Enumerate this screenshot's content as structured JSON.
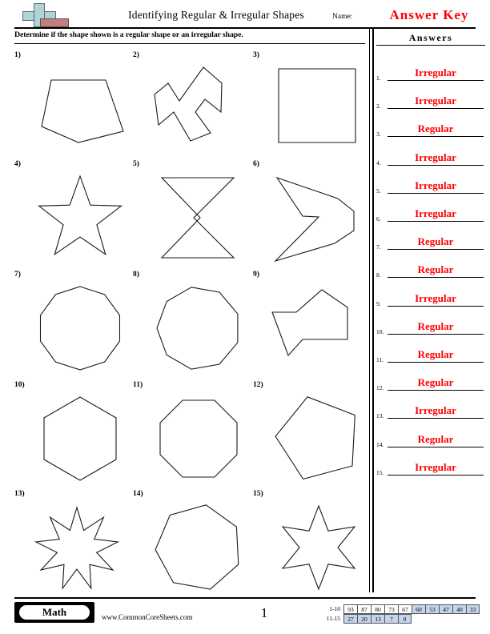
{
  "header": {
    "title": "Identifying Regular & Irregular Shapes",
    "name_label": "Name:",
    "answer_key": "Answer Key",
    "logo_colors": {
      "plus": "#aed4d8",
      "block": "#c08080"
    }
  },
  "instructions": "Determine if the shape shown is a regular shape or an irregular shape.",
  "answers_panel": {
    "heading": "Answers",
    "accent_color": "#ff0000",
    "rows": [
      {
        "num": "1.",
        "value": "Irregular"
      },
      {
        "num": "2.",
        "value": "Irregular"
      },
      {
        "num": "3.",
        "value": "Regular"
      },
      {
        "num": "4.",
        "value": "Irregular"
      },
      {
        "num": "5.",
        "value": "Irregular"
      },
      {
        "num": "6.",
        "value": "Irregular"
      },
      {
        "num": "7.",
        "value": "Regular"
      },
      {
        "num": "8.",
        "value": "Regular"
      },
      {
        "num": "9.",
        "value": "Irregular"
      },
      {
        "num": "10.",
        "value": "Regular"
      },
      {
        "num": "11.",
        "value": "Regular"
      },
      {
        "num": "12.",
        "value": "Regular"
      },
      {
        "num": "13.",
        "value": "Irregular"
      },
      {
        "num": "14.",
        "value": "Regular"
      },
      {
        "num": "15.",
        "value": "Irregular"
      }
    ]
  },
  "problems": [
    {
      "num": "1)",
      "shape": "irregular-pentagon"
    },
    {
      "num": "2)",
      "shape": "irregular-zigzag-decagon"
    },
    {
      "num": "3)",
      "shape": "square"
    },
    {
      "num": "4)",
      "shape": "five-point-star"
    },
    {
      "num": "5)",
      "shape": "hourglass-bowtie"
    },
    {
      "num": "6)",
      "shape": "chevron-arrow"
    },
    {
      "num": "7)",
      "shape": "regular-decagon"
    },
    {
      "num": "8)",
      "shape": "regular-nonagon"
    },
    {
      "num": "9)",
      "shape": "irregular-hexagon"
    },
    {
      "num": "10)",
      "shape": "regular-hexagon"
    },
    {
      "num": "11)",
      "shape": "regular-octagon"
    },
    {
      "num": "12)",
      "shape": "regular-pentagon"
    },
    {
      "num": "13)",
      "shape": "nine-point-star"
    },
    {
      "num": "14)",
      "shape": "regular-heptagon"
    },
    {
      "num": "15)",
      "shape": "six-point-star"
    }
  ],
  "footer": {
    "subject_badge": "Math",
    "site_url": "www.CommonCoreSheets.com",
    "page_number": "1",
    "score_table": {
      "row1_label": "1-10",
      "row2_label": "11-15",
      "row1": [
        {
          "v": "93",
          "blue": false
        },
        {
          "v": "87",
          "blue": false
        },
        {
          "v": "80",
          "blue": false
        },
        {
          "v": "73",
          "blue": false
        },
        {
          "v": "67",
          "blue": false
        },
        {
          "v": "60",
          "blue": true
        },
        {
          "v": "53",
          "blue": true
        },
        {
          "v": "47",
          "blue": true
        },
        {
          "v": "40",
          "blue": true
        },
        {
          "v": "33",
          "blue": true
        }
      ],
      "row2": [
        {
          "v": "27",
          "blue": true
        },
        {
          "v": "20",
          "blue": true
        },
        {
          "v": "13",
          "blue": true
        },
        {
          "v": "7",
          "blue": true
        },
        {
          "v": "0",
          "blue": true
        }
      ]
    }
  }
}
